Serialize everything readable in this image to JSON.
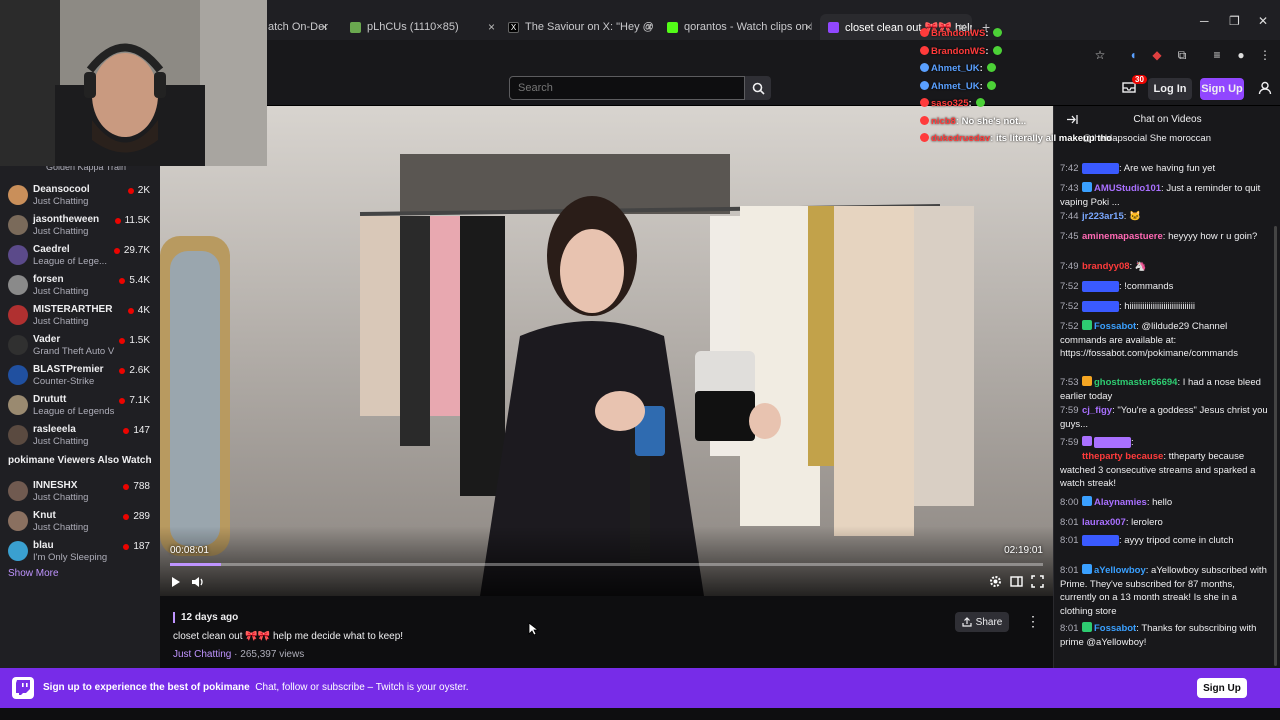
{
  "browser": {
    "tabs": [
      {
        "label": "atch On-Dema",
        "favicon": "#9147ff"
      },
      {
        "label": "pLhCUs (1110×85)",
        "favicon": "#6aa84f"
      },
      {
        "label": "The Saviour on X: \"Hey @grok",
        "favicon": "#000000"
      },
      {
        "label": "qorantos - Watch clips on Kick",
        "favicon": "#53fc18"
      },
      {
        "label": "closet clean out 🎀🎀 help me",
        "favicon": "#9147ff"
      }
    ],
    "new_tab_symbol": "+",
    "close_symbol": "×"
  },
  "nav": {
    "search_placeholder": "Search",
    "login_label": "Log In",
    "signup_label": "Sign Up",
    "notif_count": "30"
  },
  "sidebar": {
    "partial_top": "Golden Kappa Train",
    "channels": [
      {
        "name": "Deansocool",
        "game": "Just Chatting",
        "viewers": "2K",
        "color": "#c98f5a"
      },
      {
        "name": "jasontheween",
        "game": "Just Chatting",
        "viewers": "11.5K",
        "color": "#7a6a5a"
      },
      {
        "name": "Caedrel",
        "game": "League of Lege...",
        "viewers": "29.7K",
        "color": "#5b4a8a"
      },
      {
        "name": "forsen",
        "game": "Just Chatting",
        "viewers": "5.4K",
        "color": "#8a8a8a"
      },
      {
        "name": "MISTERARTHER",
        "game": "Just Chatting",
        "viewers": "4K",
        "color": "#b03030"
      },
      {
        "name": "Vader",
        "game": "Grand Theft Auto V",
        "viewers": "1.5K",
        "color": "#303030"
      },
      {
        "name": "BLASTPremier",
        "game": "Counter-Strike",
        "viewers": "2.6K",
        "color": "#2050a0"
      },
      {
        "name": "Drututt",
        "game": "League of Legends",
        "viewers": "7.1K",
        "color": "#9a8a70"
      },
      {
        "name": "rasleeela",
        "game": "Just Chatting",
        "viewers": "147",
        "color": "#5a4a40"
      }
    ],
    "also_watch_heading": "pokimane Viewers Also Watch",
    "also_watch": [
      {
        "name": "INNESHX",
        "game": "Just Chatting",
        "viewers": "788",
        "color": "#705a50"
      },
      {
        "name": "Knut",
        "game": "Just Chatting",
        "viewers": "289",
        "color": "#8a7060"
      },
      {
        "name": "blau",
        "game": "I'm Only Sleeping",
        "viewers": "187",
        "color": "#3aa0d0"
      }
    ],
    "show_more": "Show More"
  },
  "video": {
    "current_time": "00:08:01",
    "total_time": "02:19:01",
    "progress": 0.058,
    "overlay_chat": [
      {
        "user": "BrandonWS",
        "text": "",
        "color": "#ff3b3b"
      },
      {
        "user": "BrandonWS",
        "text": "",
        "color": "#ff3b3b"
      },
      {
        "user": "Ahmet_UK",
        "text": "",
        "color": "#5aa0ff"
      },
      {
        "user": "Ahmet_UK",
        "text": "",
        "color": "#5aa0ff"
      },
      {
        "user": "saso325",
        "text": "",
        "color": "#ff3b3b"
      },
      {
        "user": "nicb8",
        "text": "No she's not...",
        "color": "#ff3b3b"
      },
      {
        "user": "dukedruedav",
        "text": "its literally all makeup tho",
        "color": "#ff3b3b"
      }
    ]
  },
  "info": {
    "ago": "12 days ago",
    "title": "closet clean out 🎀🎀 help me decide what to keep!",
    "category": "Just Chatting",
    "views": "265,397 views",
    "share_label": "Share"
  },
  "chat": {
    "title": "Chat on Videos",
    "messages": [
      {
        "time": "",
        "user": "",
        "color": "#ff6a6a",
        "text": "@theblapsocial She moroccan",
        "badge": ""
      },
      {
        "time": "7:42",
        "user": "",
        "color": "#3a5aff",
        "text": "Are we having fun yet",
        "badge": ""
      },
      {
        "time": "7:43",
        "user": "AMUStudio101",
        "color": "#a970ff",
        "text": "Just a reminder to quit vaping Poki ...",
        "badge": "#3aa0ff"
      },
      {
        "time": "7:44",
        "user": "jr223ar15",
        "color": "#7aa8ff",
        "text": "🐱",
        "badge": ""
      },
      {
        "time": "7:45",
        "user": "aminemapastuere",
        "color": "#ff69b4",
        "text": "heyyyy how r u goin?",
        "badge": ""
      },
      {
        "time": "7:49",
        "user": "brandyy08",
        "color": "#ff3b3b",
        "text": "🦄",
        "badge": ""
      },
      {
        "time": "7:52",
        "user": "",
        "color": "#3a5aff",
        "text": "!commands",
        "badge": ""
      },
      {
        "time": "7:52",
        "user": "",
        "color": "#3a5aff",
        "text": "hiiiiiiiiiiiiiiiiiiiiiiiiiiiiiii",
        "badge": ""
      },
      {
        "time": "7:52",
        "user": "Fossabot",
        "color": "#3aa0ff",
        "text": "@lildude29 Channel commands are available at: https://fossabot.com/pokimane/commands",
        "badge": "#2ecc71"
      },
      {
        "time": "7:53",
        "user": "ghostmaster66694",
        "color": "#2ecc71",
        "text": "I had a nose bleed earlier today",
        "badge": "#f5a623"
      },
      {
        "time": "7:59",
        "user": "cj_figy",
        "color": "#a970ff",
        "text": "\"You're a goddess\" Jesus christ you guys...",
        "badge": ""
      },
      {
        "time": "7:59",
        "user": "",
        "color": "#a970ff",
        "text": "",
        "badge": "#a970ff"
      },
      {
        "time": "",
        "user": "ttheparty because",
        "color": "#ff3b3b",
        "text": "ttheparty because watched 3 consecutive streams and sparked a watch streak!",
        "badge": ""
      },
      {
        "time": "8:00",
        "user": "Alaynamies",
        "color": "#a970ff",
        "text": "hello",
        "badge": "#3aa0ff"
      },
      {
        "time": "8:01",
        "user": "laurax007",
        "color": "#a970ff",
        "text": "lerolero",
        "badge": ""
      },
      {
        "time": "8:01",
        "user": "",
        "color": "#3a5aff",
        "text": "ayyy tripod come in clutch",
        "badge": ""
      },
      {
        "time": "8:01",
        "user": "aYellowboy",
        "color": "#3aa0ff",
        "text": "aYellowboy subscribed with Prime. They've subscribed for 87 months, currently on a 13 month streak! Is she in a clothing store",
        "badge": "#3aa0ff"
      },
      {
        "time": "8:01",
        "user": "Fossabot",
        "color": "#3aa0ff",
        "text": "Thanks for subscribing with prime @aYellowboy!",
        "badge": "#2ecc71"
      }
    ]
  },
  "banner": {
    "bold": "Sign up to experience the best of pokimane",
    "text": "Chat, follow or subscribe – Twitch is your oyster.",
    "button": "Sign Up"
  },
  "colors": {
    "accent": "#9147ff",
    "live": "#eb0400",
    "link": "#bf94ff"
  }
}
